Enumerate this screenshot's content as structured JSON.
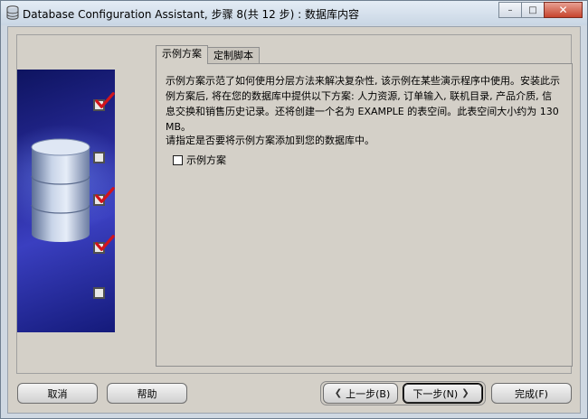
{
  "window": {
    "title": "Database Configuration Assistant, 步骤 8(共 12 步) : 数据库内容",
    "controls": {
      "minimize": "–",
      "maximize": "□",
      "close": "✕"
    }
  },
  "tabs": [
    {
      "label": "示例方案",
      "active": true
    },
    {
      "label": "定制脚本",
      "active": false
    }
  ],
  "content": {
    "description": "示例方案示范了如何使用分层方法来解决复杂性, 该示例在某些演示程序中使用。安装此示例方案后, 将在您的数据库中提供以下方案: 人力资源, 订单输入, 联机目录, 产品介质, 信息交换和销售历史记录。还将创建一个名为 EXAMPLE 的表空间。此表空间大小约为 130 MB。",
    "prompt": "请指定是否要将示例方案添加到您的数据库中。",
    "checkbox": {
      "label": "示例方案",
      "checked": false
    }
  },
  "banner": {
    "checks": [
      true,
      false,
      true,
      true,
      false
    ]
  },
  "buttons": {
    "cancel": "取消",
    "help": "帮助",
    "back": "上一步(B)",
    "next": "下一步(N)",
    "finish": "完成(F)"
  },
  "icons": {
    "back_arrow": "chevron-left-icon",
    "next_arrow": "chevron-right-icon",
    "app": "database-icon"
  }
}
